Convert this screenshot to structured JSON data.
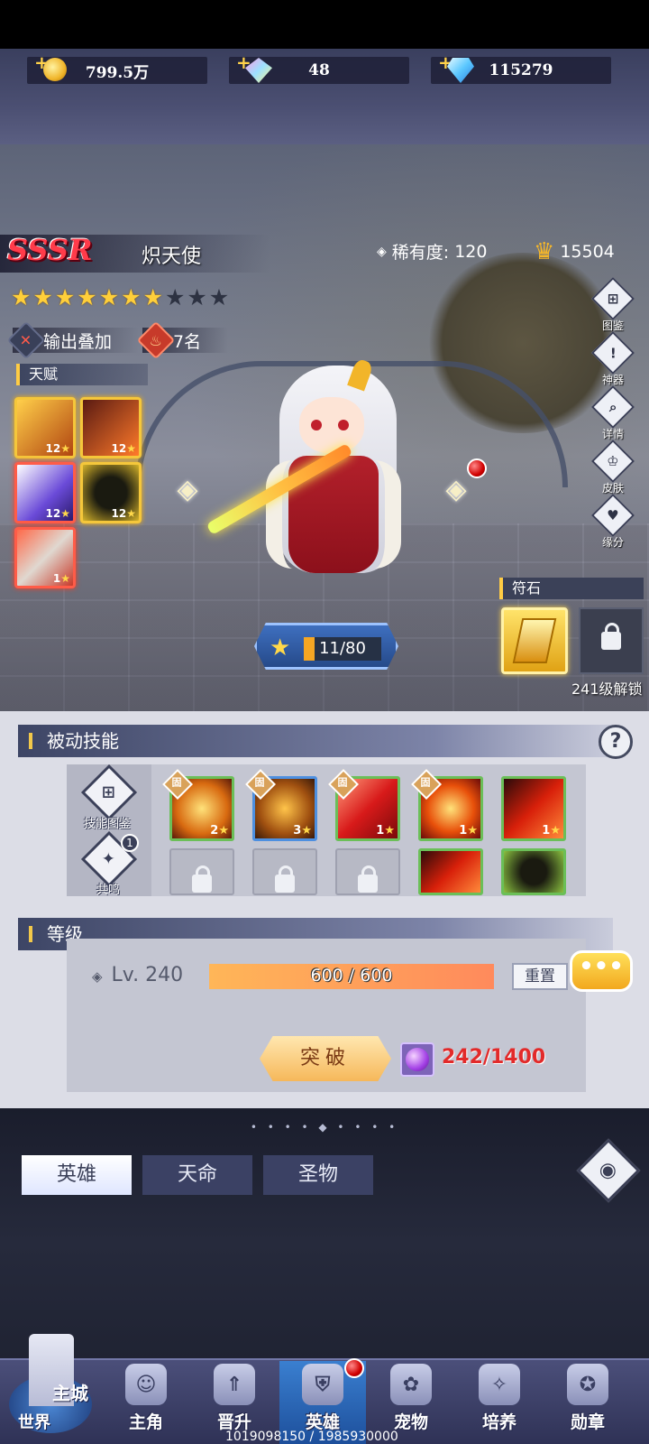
{
  "currencies": [
    {
      "icon": "gold-coin-icon",
      "value": "799.5万"
    },
    {
      "icon": "rainbow-gem-icon",
      "value": "48"
    },
    {
      "icon": "diamond-icon",
      "value": "115279"
    }
  ],
  "hero": {
    "grade": "SSSR",
    "name": "炽天使",
    "rarity_label": "稀有度:",
    "rarity_value": "120",
    "power": "15504",
    "stars_filled": 7,
    "stars_total": 10,
    "tag_output": "输出叠加",
    "tag_rank": "7名",
    "talent_label": "天赋",
    "talents": [
      "12",
      "12",
      "12",
      "12",
      "1"
    ],
    "star_level": "11/80",
    "star_level_fraction": 0.1375
  },
  "side_menu": [
    {
      "label": "图鉴",
      "icon": "codex-icon"
    },
    {
      "label": "神器",
      "icon": "artifact-icon"
    },
    {
      "label": "详情",
      "icon": "details-icon"
    },
    {
      "label": "皮肤",
      "icon": "skin-icon"
    },
    {
      "label": "缘分",
      "icon": "fate-icon"
    }
  ],
  "rune": {
    "title": "符石",
    "unlock_text": "241级解锁"
  },
  "passive": {
    "title": "被动技能",
    "help": "?",
    "codex_label": "技能图鉴",
    "resonance_label": "共鸣",
    "resonance_badge": "1",
    "fixed_tag": "固",
    "skills": [
      "2",
      "3",
      "1",
      "1",
      "1"
    ]
  },
  "level": {
    "title": "等级",
    "lv_text": "Lv. 240",
    "exp_text": "600 / 600",
    "exp_fraction": 1.0,
    "reset_label": "重置",
    "chat_label": "•••",
    "break_label": "突破",
    "break_cost": "242/1400"
  },
  "tabs": [
    {
      "label": "英雄",
      "active": true
    },
    {
      "label": "天命",
      "active": false
    },
    {
      "label": "圣物",
      "active": false
    }
  ],
  "nav": {
    "castle_label": "主城",
    "world_label": "世界",
    "items": [
      {
        "label": "主角",
        "icon": "hero-head-icon"
      },
      {
        "label": "晋升",
        "icon": "promote-icon"
      },
      {
        "label": "英雄",
        "icon": "helmet-icon"
      },
      {
        "label": "宠物",
        "icon": "pet-icon"
      },
      {
        "label": "培养",
        "icon": "train-icon"
      },
      {
        "label": "勋章",
        "icon": "medal-icon"
      }
    ]
  },
  "footer_id": "1019098150 / 1985930000",
  "colors": {
    "accent_gold": "#f5c73b",
    "sssr_red": "#ff3b4a",
    "nav_active": "#3a7fd0",
    "break_cost_red": "#e22a2a"
  }
}
